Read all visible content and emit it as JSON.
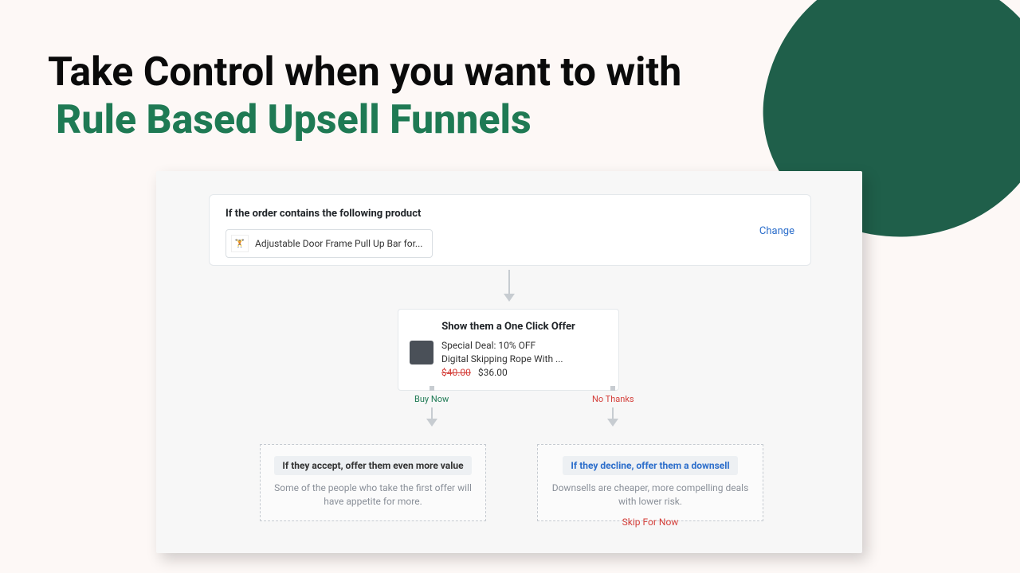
{
  "headline": {
    "line1": "Take Control when you want to with",
    "line2": "Rule Based Upsell Funnels"
  },
  "trigger": {
    "title": "If the order contains the following product",
    "product_name": "Adjustable Door Frame Pull Up Bar for...",
    "change": "Change"
  },
  "offer": {
    "title": "Show them a One Click Offer",
    "deal": "Special Deal: 10% OFF",
    "product": "Digital Skipping Rope With ...",
    "price_orig": "$40.00",
    "price_new": "$36.00"
  },
  "branches": {
    "left_label": "Buy Now",
    "right_label": "No Thanks"
  },
  "result_left": {
    "heading": "If they accept, offer them even more value",
    "desc": "Some of the people who take the first offer will have appetite for more."
  },
  "result_right": {
    "heading": "If they decline, offer them a downsell",
    "desc": "Downsells are cheaper, more compelling deals with lower risk."
  },
  "skip": "Skip For Now"
}
